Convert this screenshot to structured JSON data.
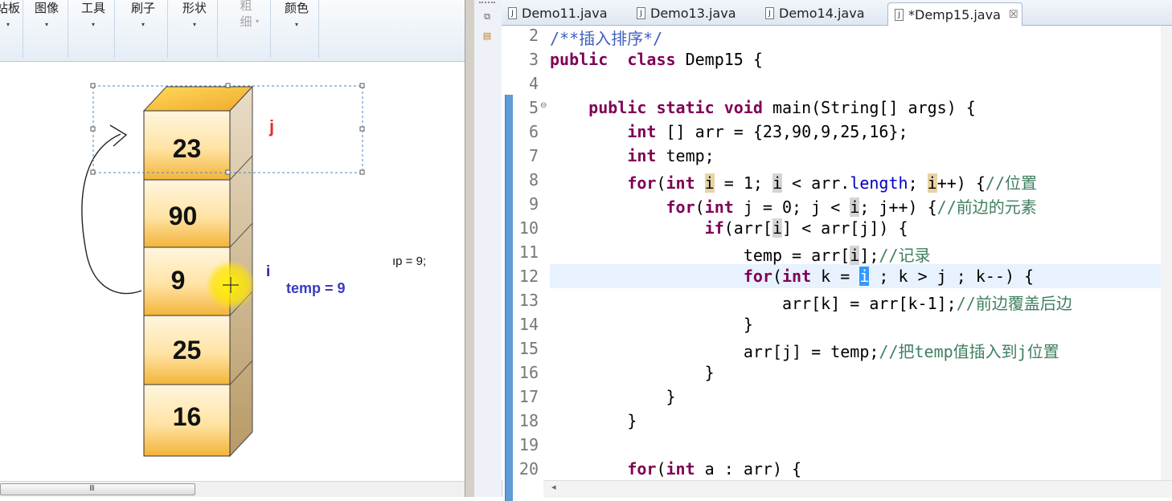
{
  "paint": {
    "ribbon": [
      {
        "label": "站板",
        "arrow": "▾"
      },
      {
        "label": "图像",
        "arrow": "▾"
      },
      {
        "label": "工具",
        "arrow": "▾"
      },
      {
        "label": "刷子",
        "arrow": "▾"
      },
      {
        "label": "形状",
        "arrow": "▾"
      },
      {
        "label": "粗\n细",
        "arrow": "▾",
        "disabled": true
      },
      {
        "label": "颜色",
        "arrow": "▾"
      }
    ],
    "cubes": [
      "23",
      "90",
      "9",
      "25",
      "16"
    ],
    "label_j": "j",
    "label_i": "i",
    "label_temp": "temp = 9",
    "partial_text": "ıp = 9;",
    "scroll_grip": "III"
  },
  "eclipse": {
    "tabs": [
      {
        "label": "Demo11.java"
      },
      {
        "label": "Demo13.java"
      },
      {
        "label": "Demo14.java"
      },
      {
        "label": "*Demp15.java",
        "close": "☒"
      }
    ],
    "line_numbers": [
      "2",
      "3",
      "4",
      "5",
      "6",
      "7",
      "8",
      "9",
      "10",
      "11",
      "12",
      "13",
      "14",
      "15",
      "16",
      "17",
      "18",
      "19",
      "20"
    ]
  },
  "colors": {
    "keyword": "#7f0055",
    "comment": "#3f7f5f",
    "javadoc": "#3f5fbf",
    "field": "#0000c0",
    "current_line": "#e8f2fe",
    "selection": "#3399ff",
    "cube_top": "#ffc93c",
    "cube_front_top": "#fff6df",
    "label_j": "#e03030",
    "label_i": "#2a2aa8"
  }
}
